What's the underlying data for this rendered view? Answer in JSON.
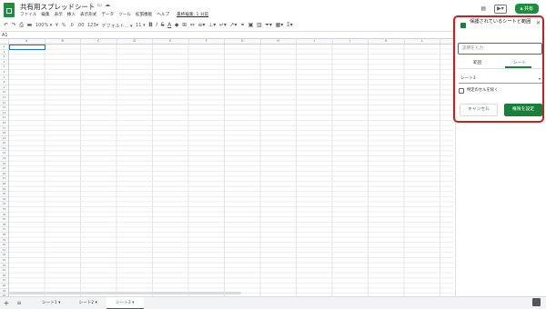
{
  "doc": {
    "title": "共有用スプレッドシート"
  },
  "menu": [
    "ファイル",
    "編集",
    "表示",
    "挿入",
    "表示形式",
    "データ",
    "ツール",
    "拡張機能",
    "ヘルプ"
  ],
  "menu_last_edit": "最終編集: 1 分前",
  "header": {
    "share_label": "共有"
  },
  "toolbar": {
    "zoom": "100%",
    "currency": "¥",
    "percent": "%",
    "decimals": ".0",
    "decimals2": ".00",
    "format123": "123",
    "font": "デフォルト...",
    "font_size": "11"
  },
  "formula_bar": {
    "name_box": "A1"
  },
  "grid": {
    "columns": [
      "A",
      "B",
      "C",
      "D",
      "E",
      "F",
      "G",
      "H",
      "I",
      "J",
      "K",
      "L"
    ],
    "rows": [
      "1",
      "2",
      "3",
      "4",
      "5",
      "6",
      "7",
      "8",
      "9",
      "10",
      "11",
      "12",
      "13",
      "14",
      "15",
      "16",
      "17",
      "18",
      "19",
      "20",
      "21",
      "22",
      "23",
      "24",
      "25",
      "26",
      "27",
      "28",
      "29",
      "30",
      "31",
      "32",
      "33",
      "34",
      "35",
      "36",
      "37",
      "38",
      "39",
      "40",
      "41",
      "42",
      "43",
      "44",
      "45",
      "46",
      "47",
      "48",
      "49",
      "50"
    ]
  },
  "sheet_tabs": {
    "tabs": [
      "シート1",
      "シート2",
      "シート3"
    ],
    "active_index": 2
  },
  "panel": {
    "title": "保護されているシートと範囲",
    "description_placeholder": "説明を入力",
    "tabs": [
      "範囲",
      "シート"
    ],
    "active_tab": "シート",
    "selected_sheet": "シート3",
    "exclude_cells_label": "特定のセルを除く",
    "cancel_label": "キャンセル",
    "set_permissions_label": "権限を設定"
  },
  "colors": {
    "brand_green": "#188038",
    "highlight_red": "#c5221f",
    "selection_blue": "#1a73e8"
  }
}
